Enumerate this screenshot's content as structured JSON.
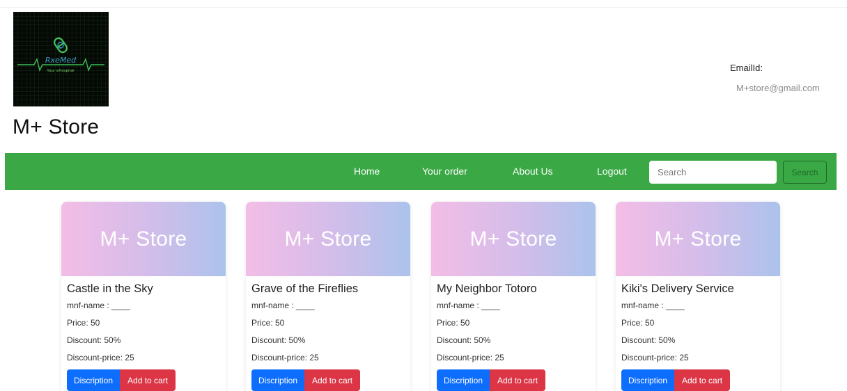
{
  "header": {
    "logo": {
      "brand_text": "RxeMed",
      "tagline_text": "Your eHospital",
      "colors": {
        "background": "#050805",
        "accent": "#3fbf57",
        "text": "#3aa0c8"
      }
    },
    "store_title": "M+ Store",
    "email_label": "EmailId:",
    "email_value": "M+store@gmail.com"
  },
  "navbar": {
    "background": "#3aa845",
    "links": [
      "Home",
      "Your order",
      "About Us",
      "Logout"
    ],
    "search_placeholder": "Search",
    "search_button": "Search"
  },
  "cards": [
    {
      "banner": "M+ Store",
      "title": "Castle in the Sky",
      "mnf": "mnf-name : ____",
      "price": "Price: 50",
      "discount": "Discount: 50%",
      "discount_price": "Discount-price: 25",
      "desc_button": "Discription",
      "cart_button": "Add to cart"
    },
    {
      "banner": "M+ Store",
      "title": "Grave of the Fireflies",
      "mnf": "mnf-name : ____",
      "price": "Price: 50",
      "discount": "Discount: 50%",
      "discount_price": "Discount-price: 25",
      "desc_button": "Discription",
      "cart_button": "Add to cart"
    },
    {
      "banner": "M+ Store",
      "title": "My Neighbor Totoro",
      "mnf": "mnf-name : ____",
      "price": "Price: 50",
      "discount": "Discount: 50%",
      "discount_price": "Discount-price: 25",
      "desc_button": "Discription",
      "cart_button": "Add to cart"
    },
    {
      "banner": "M+ Store",
      "title": "Kiki's Delivery Service",
      "mnf": "mnf-name : ____",
      "price": "Price: 50",
      "discount": "Discount: 50%",
      "discount_price": "Discount-price: 25",
      "desc_button": "Discription",
      "cart_button": "Add to cart"
    }
  ],
  "colors": {
    "description_button": "#0d6efd",
    "add_to_cart_button": "#dc3545",
    "banner_gradient": [
      "#f3bde6",
      "#d2bdea",
      "#abc3ec"
    ]
  }
}
